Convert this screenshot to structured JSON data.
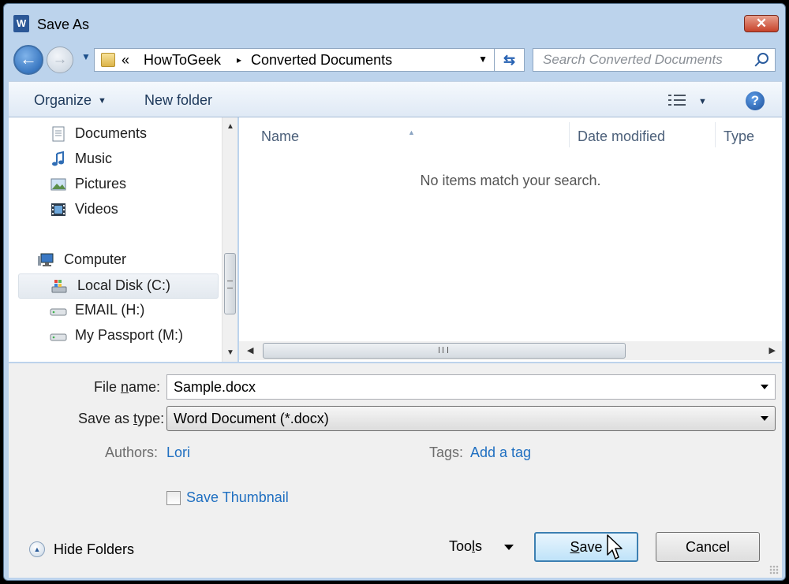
{
  "window": {
    "title": "Save As",
    "app_icon": "W",
    "close": "✕"
  },
  "nav": {
    "back_glyph": "←",
    "forward_glyph": "→",
    "address": {
      "overflow": "«",
      "crumbs": [
        "HowToGeek",
        "Converted Documents"
      ],
      "sep": "▸",
      "drop": "▼"
    },
    "refresh_glyph": "⇆",
    "search_placeholder": "Search Converted Documents"
  },
  "toolbar": {
    "organize": "Organize",
    "new_folder": "New folder",
    "caret": "▼",
    "help": "?"
  },
  "sidebar": {
    "items": [
      {
        "label": "Documents",
        "icon": "documents-icon"
      },
      {
        "label": "Music",
        "icon": "music-icon"
      },
      {
        "label": "Pictures",
        "icon": "pictures-icon"
      },
      {
        "label": "Videos",
        "icon": "videos-icon"
      },
      {
        "label": "Computer",
        "icon": "computer-icon"
      },
      {
        "label": "Local Disk (C:)",
        "icon": "local-disk-icon",
        "selected": true
      },
      {
        "label": "EMAIL (H:)",
        "icon": "drive-icon"
      },
      {
        "label": "My Passport (M:)",
        "icon": "drive-icon"
      }
    ],
    "scroll_up": "▲",
    "scroll_down": "▼"
  },
  "filelist": {
    "columns": [
      "Name",
      "Date modified",
      "Type"
    ],
    "sort_indicator": "▲",
    "empty_message": "No items match your search.",
    "scroll_left": "◀",
    "scroll_right": "▶"
  },
  "form": {
    "filename_label_pre": "File ",
    "filename_label_u": "n",
    "filename_label_post": "ame:",
    "filename_value": "Sample.docx",
    "type_label_pre": "Save as ",
    "type_label_u": "t",
    "type_label_post": "ype:",
    "type_value": "Word Document (*.docx)",
    "authors_label": "Authors:",
    "authors_value": "Lori",
    "tags_label": "Tags:",
    "tags_value": "Add a tag",
    "thumbnail_label": "Save Thumbnail",
    "thumbnail_checked": false
  },
  "footer": {
    "hide_folders": "Hide Folders",
    "hide_glyph": "▲",
    "tools_pre": "Too",
    "tools_u": "l",
    "tools_post": "s",
    "save_u": "S",
    "save_post": "ave",
    "cancel": "Cancel"
  },
  "colors": {
    "accent": "#1f6fc1",
    "frame": "#bcd3ec",
    "close": "#c7432b"
  }
}
